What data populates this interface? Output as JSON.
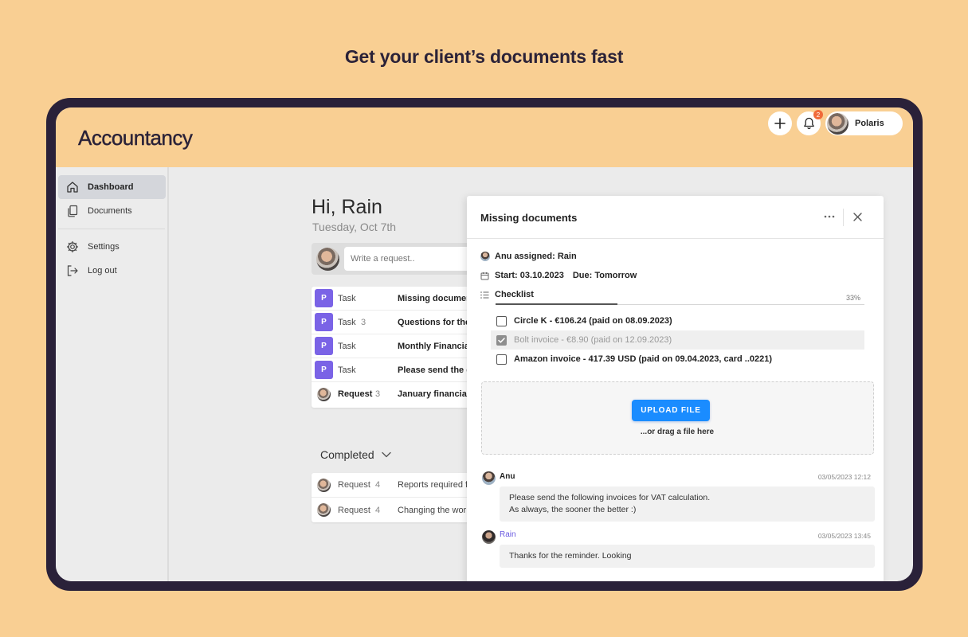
{
  "headline": "Get your client’s documents fast",
  "app": {
    "title": "Accountancy",
    "notification_count": "2",
    "user_name": "Polaris"
  },
  "sidebar": {
    "items": [
      {
        "label": "Dashboard",
        "icon": "home-icon",
        "active": true
      },
      {
        "label": "Documents",
        "icon": "documents-icon"
      },
      {
        "label": "Settings",
        "icon": "gear-icon"
      },
      {
        "label": "Log out",
        "icon": "logout-icon"
      }
    ]
  },
  "dashboard": {
    "greeting": "Hi, Rain",
    "date": "Tuesday, Oct 7th",
    "composer_placeholder": "Write a request..",
    "tasks": [
      {
        "badge": "P",
        "type": "Task",
        "count": "",
        "title": "Missing documen"
      },
      {
        "badge": "P",
        "type": "Task",
        "count": "3",
        "title": "Questions for the"
      },
      {
        "badge": "P",
        "type": "Task",
        "count": "",
        "title": "Monthly Financial"
      },
      {
        "badge": "P",
        "type": "Task",
        "count": "",
        "title": "Please send the d"
      },
      {
        "badge": "",
        "type": "Request",
        "count": "3",
        "title": "January financial"
      }
    ],
    "completed_label": "Completed",
    "completed": [
      {
        "type": "Request",
        "count": "4",
        "title": "Reports required f"
      },
      {
        "type": "Request",
        "count": "4",
        "title": "Changing the wor"
      }
    ]
  },
  "panel": {
    "title": "Missing documents",
    "assigned": "Anu assigned: Rain",
    "start": "Start: 03.10.2023",
    "due": "Due: Tomorrow",
    "checklist_label": "Checklist",
    "checklist_percent": "33%",
    "checklist_progress": 0.33,
    "checklist": [
      {
        "label": "Circle K - €106.24 (paid on 08.09.2023)",
        "checked": false
      },
      {
        "label": "Bolt invoice - €8.90 (paid on 12.09.2023)",
        "checked": true
      },
      {
        "label": "Amazon invoice - 417.39 USD (paid on 09.04.2023, card ..0221)",
        "checked": false
      }
    ],
    "upload_label": "UPLOAD FILE",
    "drag_text": "...or drag a file here",
    "messages": [
      {
        "author": "Anu",
        "time": "03/05/2023 12:12",
        "lines": [
          "Please send the following invoices for VAT calculation.",
          "As always, the sooner the better :)"
        ]
      },
      {
        "author": "Rain",
        "time": "03/05/2023 13:45",
        "lines": [
          "Thanks for the reminder. Looking"
        ]
      }
    ]
  },
  "colors": {
    "background": "#F9CF93",
    "device_frame": "#2A2139",
    "accent_purple": "#7A63E6",
    "upload_blue": "#1A8CFF",
    "badge_orange": "#F06A3A"
  }
}
